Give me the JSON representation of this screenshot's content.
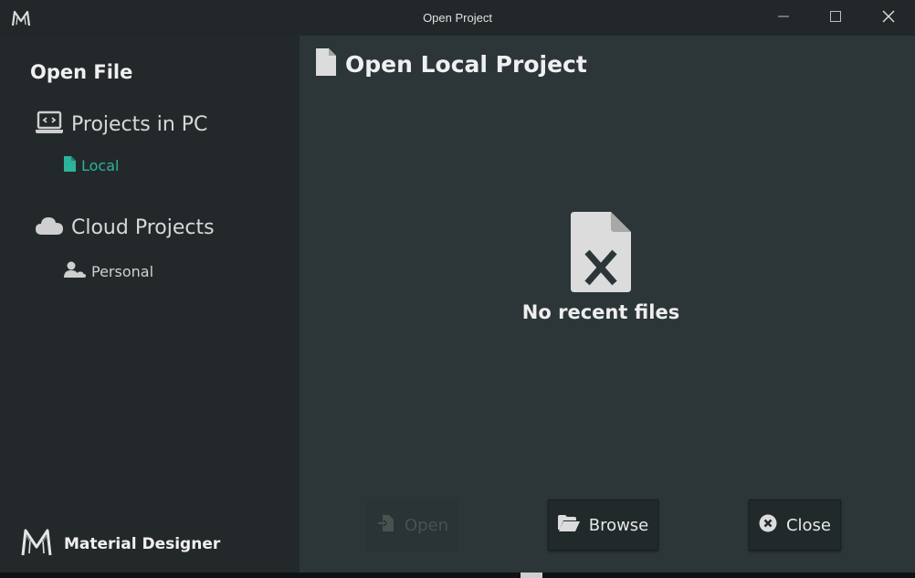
{
  "window": {
    "title": "Open Project",
    "app_icon": "material-designer-logo-icon",
    "controls": [
      "minimize-icon",
      "maximize-icon",
      "close-icon"
    ]
  },
  "sidebar": {
    "heading": "Open File",
    "groups": [
      {
        "label": "Projects in PC",
        "icon": "laptop-code-icon",
        "items": [
          {
            "label": "Local",
            "icon": "file-icon",
            "selected": true
          }
        ]
      },
      {
        "label": "Cloud Projects",
        "icon": "cloud-icon",
        "items": [
          {
            "label": "Personal",
            "icon": "user-cloud-icon",
            "selected": false
          }
        ]
      }
    ],
    "brand": "Material Designer"
  },
  "main": {
    "title": "Open Local Project",
    "title_icon": "file-icon",
    "empty_icon": "file-excel-icon",
    "empty_text": "No recent files",
    "buttons": {
      "open": {
        "label": "Open",
        "icon": "file-import-icon",
        "disabled": true
      },
      "browse": {
        "label": "Browse",
        "icon": "folder-open-icon",
        "disabled": false
      },
      "close": {
        "label": "Close",
        "icon": "times-circle-icon",
        "disabled": false
      }
    }
  },
  "colors": {
    "accent": "#2bb39b",
    "sidebar_bg": "#23292b",
    "main_bg": "#2c3639",
    "titlebar_bg": "#22282a"
  }
}
